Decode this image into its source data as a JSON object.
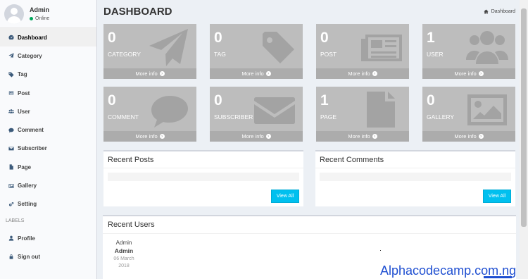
{
  "user": {
    "name": "Admin",
    "status": "Online"
  },
  "menu": [
    {
      "label": "Dashboard",
      "icon": "dashboard-icon",
      "active": true
    },
    {
      "label": "Category",
      "icon": "send-icon"
    },
    {
      "label": "Tag",
      "icon": "tag-icon"
    },
    {
      "label": "Post",
      "icon": "newspaper-icon"
    },
    {
      "label": "User",
      "icon": "users-icon"
    },
    {
      "label": "Comment",
      "icon": "comment-icon"
    },
    {
      "label": "Subscriber",
      "icon": "envelope-icon"
    },
    {
      "label": "Page",
      "icon": "file-icon"
    },
    {
      "label": "Gallery",
      "icon": "image-icon"
    },
    {
      "label": "Setting",
      "icon": "cogs-icon"
    }
  ],
  "menu_header": "LABELS",
  "menu_bottom": [
    {
      "label": "Profile",
      "icon": "user-icon"
    },
    {
      "label": "Sign out",
      "icon": "lock-icon"
    }
  ],
  "page": {
    "title": "DASHBOARD",
    "breadcrumb": "Dashboard"
  },
  "boxes": [
    {
      "count": "0",
      "label": "CATEGORY",
      "icon": "paper-plane-icon",
      "more": "More info"
    },
    {
      "count": "0",
      "label": "TAG",
      "icon": "tag-icon",
      "more": "More info"
    },
    {
      "count": "0",
      "label": "POST",
      "icon": "newspaper-icon",
      "more": "More info"
    },
    {
      "count": "1",
      "label": "USER",
      "icon": "users-icon",
      "more": "More info"
    },
    {
      "count": "0",
      "label": "COMMENT",
      "icon": "comment-icon",
      "more": "More info"
    },
    {
      "count": "0",
      "label": "SUBSCRIBER",
      "icon": "envelope-icon",
      "more": "More info"
    },
    {
      "count": "1",
      "label": "PAGE",
      "icon": "file-icon",
      "more": "More info"
    },
    {
      "count": "0",
      "label": "GALLERY",
      "icon": "picture-icon",
      "more": "More info"
    }
  ],
  "recent_posts": {
    "title": "Recent Posts",
    "button": "View All"
  },
  "recent_comments": {
    "title": "Recent Comments",
    "button": "View All"
  },
  "recent_users": {
    "title": "Recent Users",
    "users": [
      {
        "top": "Admin",
        "name": "Admin",
        "date": "06 March 2018"
      }
    ]
  },
  "watermark": "Alphacodecamp.com.ng",
  "colors": {
    "box_bg": "#bdbdbd",
    "box_footer": "#acacac",
    "button": "#00c0ef",
    "online": "#00a65a",
    "watermark": "#1f4fd1"
  }
}
